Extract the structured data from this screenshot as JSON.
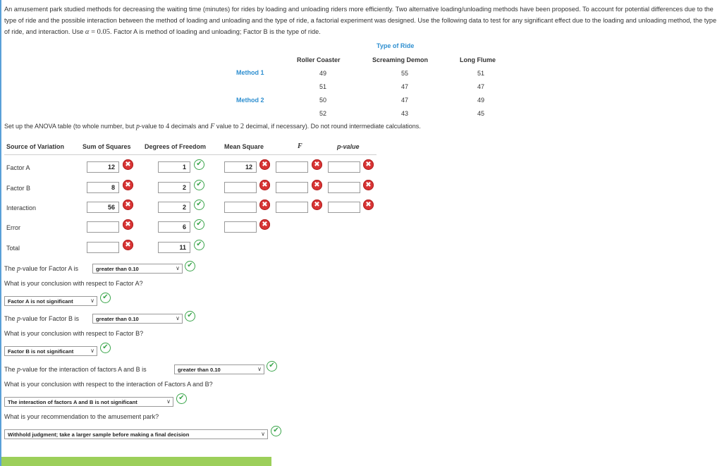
{
  "intro": {
    "part1": "An amusement park studied methods for decreasing the waiting time (minutes) for rides by loading and unloading riders more efficiently. Two alternative loading/unloading methods have been proposed. To account for potential differences due to the type of ride and the possible interaction between the method of loading and unloading and the type of ride, a factorial experiment was designed. Use the following data to test for any significant effect due to the loading and unloading method, the type of ride, and interaction. Use ",
    "alpha_symbol": "α",
    "alpha_eq": " = ",
    "alpha_value": "0.05",
    "part2": ". Factor A is method of loading and unloading; Factor B is the type of ride."
  },
  "data_table": {
    "type_label": "Type of Ride",
    "columns": [
      "Roller Coaster",
      "Screaming Demon",
      "Long Flume"
    ],
    "methods": [
      {
        "label": "Method 1",
        "rows": [
          [
            "49",
            "55",
            "51"
          ],
          [
            "51",
            "47",
            "47"
          ]
        ]
      },
      {
        "label": "Method 2",
        "rows": [
          [
            "50",
            "47",
            "49"
          ],
          [
            "52",
            "43",
            "45"
          ]
        ]
      }
    ]
  },
  "instructions": {
    "t1": "Set up the ANOVA table (to whole number, but ",
    "p": "p",
    "t2": "-value to ",
    "n4": "4",
    "t3": " decimals and ",
    "F": "F",
    "t4": " value to ",
    "n2": "2",
    "t5": " decimal, if necessary). Do not round intermediate calculations."
  },
  "anova": {
    "headers": {
      "source": "Source of Variation",
      "ss": "Sum of Squares",
      "df": "Degrees of Freedom",
      "ms": "Mean Square",
      "f": "F",
      "p": "p-value"
    },
    "rows": [
      {
        "label": "Factor A",
        "ss": "12",
        "df": "1",
        "ms": "12",
        "f": "",
        "p": ""
      },
      {
        "label": "Factor B",
        "ss": "8",
        "df": "2",
        "ms": "",
        "f": "",
        "p": ""
      },
      {
        "label": "Interaction",
        "ss": "56",
        "df": "2",
        "ms": "",
        "f": "",
        "p": ""
      },
      {
        "label": "Error",
        "ss": "",
        "df": "6",
        "ms": ""
      },
      {
        "label": "Total",
        "ss": "",
        "df": "11"
      }
    ],
    "wrong_glyph": "✖",
    "right_glyph": "✔"
  },
  "questions": {
    "pa_prefix": "The ",
    "p": "p",
    "pa_suffix": "-value for Factor A is",
    "pa_value": "greater than 0.10",
    "qa": "What is your conclusion with respect to Factor A?",
    "qa_value": "Factor A is not significant",
    "pb_suffix": "-value for Factor B is",
    "pb_value": "greater than 0.10",
    "qb": "What is your conclusion with respect to Factor B?",
    "qb_value": "Factor B is not significant",
    "pi_suffix": "-value for the interaction of factors A and B is",
    "pi_value": "greater than 0.10",
    "qi": "What is your conclusion with respect to the interaction of Factors A and B?",
    "qi_value": "The interaction of factors A and B is not significant",
    "qr": "What is your recommendation to the amusement park?",
    "qr_value": "Withhold judgment; take a larger sample before making a final decision"
  },
  "colors": {
    "accent": "#2e8fd0",
    "wrong": "#d83434",
    "right": "#3aa54a",
    "bar": "#9ccf5a"
  }
}
